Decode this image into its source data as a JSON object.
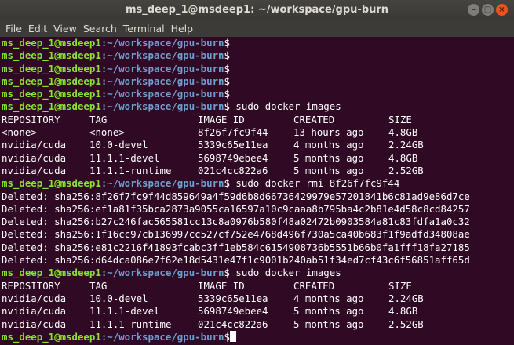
{
  "window": {
    "title": "ms_deep_1@msdeep1: ~/workspace/gpu-burn",
    "controls": {
      "minimize": "–",
      "maximize": "□",
      "close": "×"
    }
  },
  "menu": [
    "File",
    "Edit",
    "View",
    "Search",
    "Terminal",
    "Help"
  ],
  "prompt": {
    "user": "ms_deep_1@msdeep1",
    "path": ":~/workspace/gpu-burn",
    "symbol": "$"
  },
  "commands": {
    "images": " sudo docker images",
    "rmi": " sudo docker rmi 8f26f7fc9f44",
    "empty": ""
  },
  "headers": [
    "REPOSITORY",
    "TAG",
    "IMAGE ID",
    "CREATED",
    "SIZE"
  ],
  "images_before": [
    [
      "<none>",
      "<none>",
      "8f26f7fc9f44",
      "13 hours ago",
      "4.8GB"
    ],
    [
      "nvidia/cuda",
      "10.0-devel",
      "5339c65e11ea",
      "4 months ago",
      "2.24GB"
    ],
    [
      "nvidia/cuda",
      "11.1.1-devel",
      "5698749ebee4",
      "5 months ago",
      "4.8GB"
    ],
    [
      "nvidia/cuda",
      "11.1.1-runtime",
      "021c4cc822a6",
      "5 months ago",
      "2.52GB"
    ]
  ],
  "deleted": [
    "Deleted: sha256:8f26f7fc9f44d859649a4f59d6b8d66736429979e57201841b6c81ad9e86d7ce",
    "Deleted: sha256:ef1a81f35bca2873a9055ca16597a10c9caaa8b795ba4c2b81e4d58c8cd84257",
    "Deleted: sha256:b27c246fac565581cc13c8a0976b580f48a02472b0903584a81c83fdfa1a0c32",
    "Deleted: sha256:1f16cc97cb136997cc527cf752e4768d496f730a5ca40b683f1f9adfd34808ae",
    "Deleted: sha256:e81c2216f41893fcabc3ff1eb584c6154908736b5551b66b0fa1fff18fa27185",
    "Deleted: sha256:d64dca086e7f62e18d5431e47f1c9001b240ab51f34ed7cf43c6f56851aff65d"
  ],
  "images_after": [
    [
      "nvidia/cuda",
      "10.0-devel",
      "5339c65e11ea",
      "4 months ago",
      "2.24GB"
    ],
    [
      "nvidia/cuda",
      "11.1.1-devel",
      "5698749ebee4",
      "5 months ago",
      "4.8GB"
    ],
    [
      "nvidia/cuda",
      "11.1.1-runtime",
      "021c4cc822a6",
      "5 months ago",
      "2.52GB"
    ]
  ],
  "colors": {
    "background": "#300a24",
    "prompt_user": "#8ae234",
    "prompt_path": "#729fcf",
    "text": "#ffffff"
  }
}
